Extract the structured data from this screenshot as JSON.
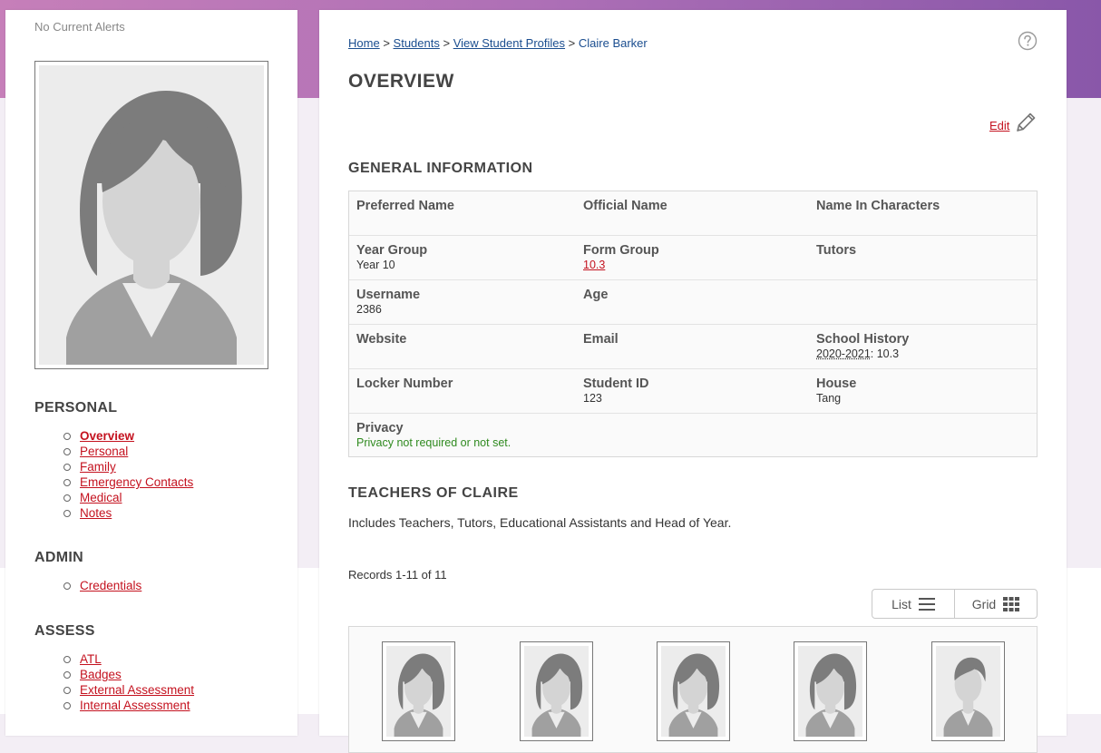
{
  "sidebar": {
    "alerts": "No Current Alerts",
    "sections": [
      {
        "heading": "PERSONAL",
        "items": [
          "Overview",
          "Personal",
          "Family",
          "Emergency Contacts",
          "Medical",
          "Notes"
        ]
      },
      {
        "heading": "ADMIN",
        "items": [
          "Credentials"
        ]
      },
      {
        "heading": "ASSESS",
        "items": [
          "ATL",
          "Badges",
          "External Assessment",
          "Internal Assessment"
        ]
      }
    ]
  },
  "breadcrumb": [
    "Home",
    "Students",
    "View Student Profiles",
    "Claire Barker"
  ],
  "breadcrumb_separator": ">",
  "page_title": "OVERVIEW",
  "edit_label": "Edit",
  "general": {
    "title": "GENERAL INFORMATION",
    "preferred_name": {
      "label": "Preferred Name",
      "value": ""
    },
    "official_name": {
      "label": "Official Name",
      "value": ""
    },
    "name_in_characters": {
      "label": "Name In Characters",
      "value": ""
    },
    "year_group": {
      "label": "Year Group",
      "value": "Year 10"
    },
    "form_group": {
      "label": "Form Group",
      "value": "10.3"
    },
    "tutors": {
      "label": "Tutors",
      "value": ""
    },
    "username": {
      "label": "Username",
      "value": "2386"
    },
    "age": {
      "label": "Age",
      "value": ""
    },
    "website": {
      "label": "Website",
      "value": ""
    },
    "email": {
      "label": "Email",
      "value": ""
    },
    "school_history": {
      "label": "School History",
      "year": "2020-2021",
      "group": ": 10.3"
    },
    "locker_number": {
      "label": "Locker Number",
      "value": ""
    },
    "student_id": {
      "label": "Student ID",
      "value": "123"
    },
    "house": {
      "label": "House",
      "value": "Tang"
    },
    "privacy": {
      "label": "Privacy",
      "value": "Privacy not required or not set."
    }
  },
  "teachers": {
    "title": "TEACHERS OF CLAIRE",
    "description": "Includes Teachers, Tutors, Educational Assistants and Head of Year.",
    "records": "Records 1-11 of 11",
    "list_label": "List",
    "grid_label": "Grid",
    "thumbnail_genders": [
      "female",
      "female",
      "female",
      "female",
      "male"
    ]
  },
  "colors": {
    "link_red": "#c4121f",
    "link_blue": "#1a4d8f",
    "privacy_green": "#2f8a1f",
    "banner_start": "#c67fb9",
    "banner_end": "#8957a9"
  },
  "icons": [
    "question-circle-icon",
    "pencil-icon",
    "hamburger-list-icon",
    "grid-icon",
    "female-silhouette-icon",
    "male-silhouette-icon"
  ]
}
